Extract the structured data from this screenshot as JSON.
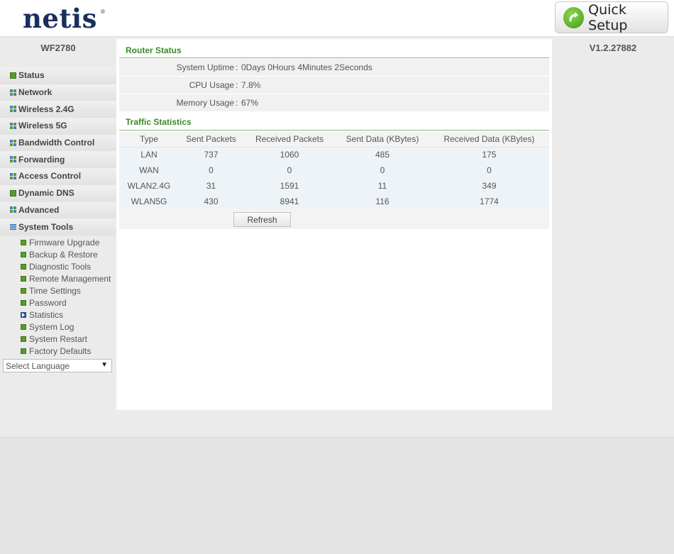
{
  "header": {
    "logo_text": "netis",
    "logo_mark": "®",
    "quick_setup_label": "Quick Setup",
    "quick_setup_icon": "refresh-arrow-icon"
  },
  "device": {
    "model": "WF2780",
    "version": "V1.2.27882"
  },
  "sidebar": {
    "items": [
      {
        "label": "Status",
        "icon": "square-icon"
      },
      {
        "label": "Network",
        "icon": "grid-icon"
      },
      {
        "label": "Wireless 2.4G",
        "icon": "grid-icon"
      },
      {
        "label": "Wireless 5G",
        "icon": "grid-icon"
      },
      {
        "label": "Bandwidth Control",
        "icon": "grid-icon"
      },
      {
        "label": "Forwarding",
        "icon": "grid-icon"
      },
      {
        "label": "Access Control",
        "icon": "grid-icon"
      },
      {
        "label": "Dynamic DNS",
        "icon": "grid-icon"
      },
      {
        "label": "Advanced",
        "icon": "grid-icon"
      },
      {
        "label": "System Tools",
        "icon": "list-icon"
      }
    ],
    "sub_items": [
      {
        "label": "Firmware Upgrade"
      },
      {
        "label": "Backup & Restore"
      },
      {
        "label": "Diagnostic Tools"
      },
      {
        "label": "Remote Management"
      },
      {
        "label": "Time Settings"
      },
      {
        "label": "Password"
      },
      {
        "label": "Statistics",
        "active": true
      },
      {
        "label": "System Log"
      },
      {
        "label": "System Restart"
      },
      {
        "label": "Factory Defaults"
      }
    ],
    "language_select": {
      "value": "Select Language"
    }
  },
  "router_status": {
    "title": "Router Status",
    "rows": [
      {
        "label": "System Uptime",
        "value": "0Days 0Hours 4Minutes 2Seconds"
      },
      {
        "label": "CPU Usage",
        "value": "7.8%"
      },
      {
        "label": "Memory Usage",
        "value": "67%"
      }
    ]
  },
  "traffic": {
    "title": "Traffic Statistics",
    "columns": [
      "Type",
      "Sent Packets",
      "Received Packets",
      "Sent Data (KBytes)",
      "Received Data (KBytes)"
    ],
    "rows": [
      [
        "LAN",
        "737",
        "1060",
        "485",
        "175"
      ],
      [
        "WAN",
        "0",
        "0",
        "0",
        "0"
      ],
      [
        "WLAN2.4G",
        "31",
        "1591",
        "11",
        "349"
      ],
      [
        "WLAN5G",
        "430",
        "8941",
        "116",
        "1774"
      ]
    ],
    "refresh_label": "Refresh"
  },
  "colors": {
    "accent_green": "#3a8a28",
    "logo_navy": "#1b2f5e"
  }
}
